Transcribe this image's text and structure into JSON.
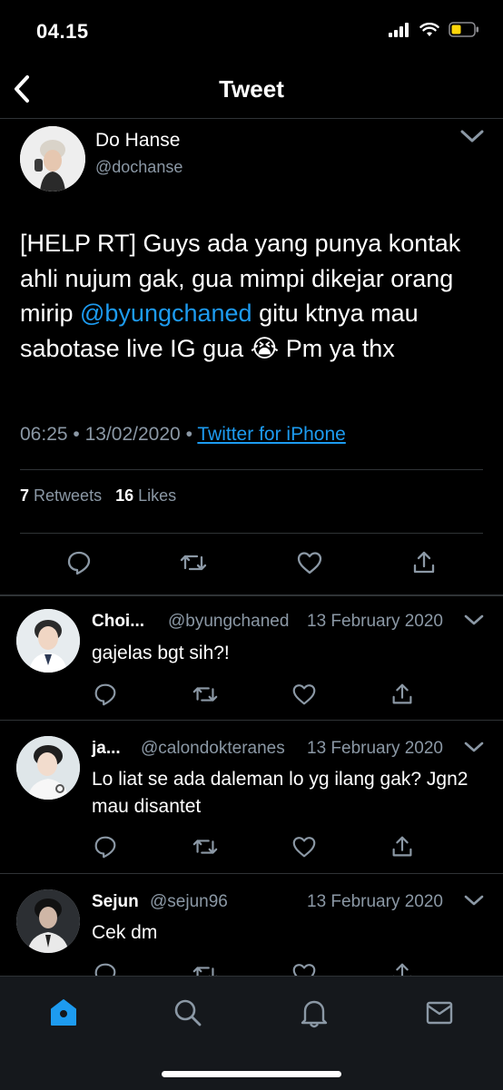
{
  "status_bar": {
    "time": "04.15"
  },
  "nav": {
    "title": "Tweet"
  },
  "tweet": {
    "author_name": "Do Hanse",
    "author_handle": "@dochanse",
    "text_part1": "[HELP RT] Guys ada yang punya kontak ahli nujum gak, gua mimpi dikejar orang mirip ",
    "mention": "@byungchaned",
    "text_part2": " gitu ktnya mau sabotase live IG gua ",
    "emoji": "😭",
    "text_part3": " Pm ya thx",
    "time": "06:25",
    "date": "13/02/2020",
    "separator": "•",
    "source": "Twitter for iPhone",
    "retweet_count": "7",
    "retweet_label": "Retweets",
    "like_count": "16",
    "like_label": "Likes"
  },
  "replies": [
    {
      "name": "Choi...",
      "handle": "@byungchaned",
      "date": "13 February 2020",
      "text": "gajelas bgt sih?!"
    },
    {
      "name": "ja...",
      "handle": "@calondokteranes",
      "date": "13 February 2020",
      "text": "Lo liat se ada daleman lo yg ilang gak? Jgn2 mau disantet"
    },
    {
      "name": "Sejun",
      "handle": "@sejun96",
      "date": "13 February 2020",
      "text": "Cek dm"
    }
  ],
  "icons": {
    "back": "chevron-left-icon",
    "more": "chevron-down-icon",
    "reply": "reply-icon",
    "retweet": "retweet-icon",
    "like": "heart-icon",
    "share": "share-icon",
    "tab_home": "home-icon",
    "tab_search": "search-icon",
    "tab_notifications": "bell-icon",
    "tab_messages": "mail-icon"
  },
  "colors": {
    "accent": "#1d9bf0",
    "muted": "#8b98a5",
    "background": "#000000",
    "battery": "#ffd60a"
  }
}
